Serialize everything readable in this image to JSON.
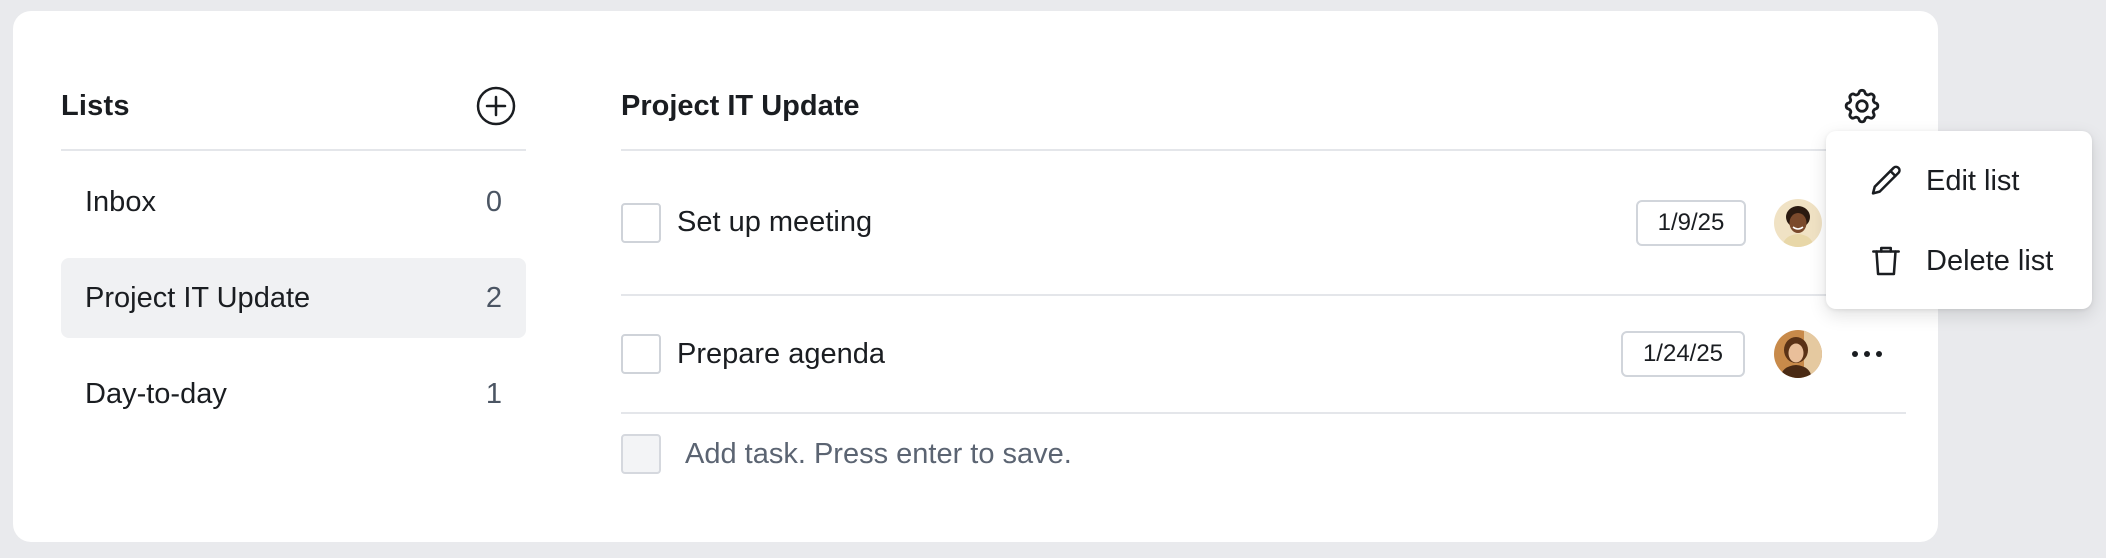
{
  "sidebar": {
    "title": "Lists",
    "add_icon": "plus-circle-icon",
    "items": [
      {
        "label": "Inbox",
        "count": "0",
        "active": false
      },
      {
        "label": "Project IT Update",
        "count": "2",
        "active": true
      },
      {
        "label": "Day-to-day",
        "count": "1",
        "active": false
      }
    ]
  },
  "main": {
    "title": "Project IT Update",
    "settings_icon": "gear-icon",
    "tasks": [
      {
        "title": "Set up meeting",
        "date": "1/9/25",
        "avatar": "avatar-woman-1"
      },
      {
        "title": "Prepare agenda",
        "date": "1/24/25",
        "avatar": "avatar-woman-2",
        "more_icon": "more-horizontal-icon"
      }
    ],
    "add_task": {
      "placeholder": "Add task. Press enter to save."
    }
  },
  "menu": {
    "items": [
      {
        "label": "Edit list",
        "icon": "pencil-icon"
      },
      {
        "label": "Delete list",
        "icon": "trash-icon"
      }
    ]
  },
  "colors": {
    "background": "#e9eaed",
    "card": "#ffffff",
    "active_item": "#f0f1f3",
    "divider": "#e4e6ea",
    "muted_text": "#5b6472"
  }
}
